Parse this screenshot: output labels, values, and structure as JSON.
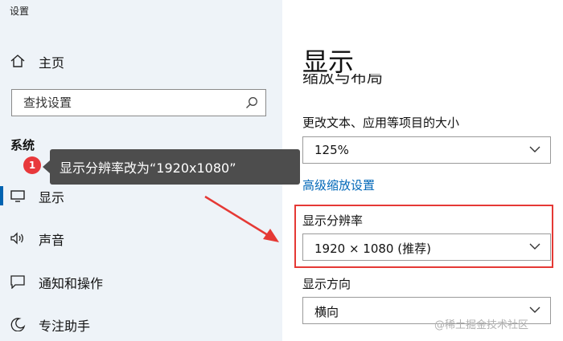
{
  "window": {
    "title": "设置"
  },
  "sidebar": {
    "home_label": "主页",
    "search_placeholder": "查找设置",
    "section_title": "系统",
    "items": [
      {
        "label": "显示",
        "icon": "monitor-icon",
        "active": true
      },
      {
        "label": "声音",
        "icon": "speaker-icon"
      },
      {
        "label": "通知和操作",
        "icon": "notification-icon"
      },
      {
        "label": "专注助手",
        "icon": "moon-icon"
      }
    ]
  },
  "annotation": {
    "step": "1",
    "text": "显示分辨率改为“1920x1080”",
    "color": "#e53935"
  },
  "main": {
    "title": "显示",
    "clipped_heading": "缩放与布局",
    "scale": {
      "label": "更改文本、应用等项目的大小",
      "value": "125%"
    },
    "advanced_link": "高级缩放设置",
    "resolution": {
      "label": "显示分辨率",
      "value": "1920 × 1080 (推荐)"
    },
    "orientation": {
      "label": "显示方向",
      "value": "横向"
    }
  },
  "watermark": "@稀土掘金技术社区",
  "colors": {
    "accent": "#0063b1",
    "link": "#0067b8",
    "highlight": "#e53935"
  }
}
